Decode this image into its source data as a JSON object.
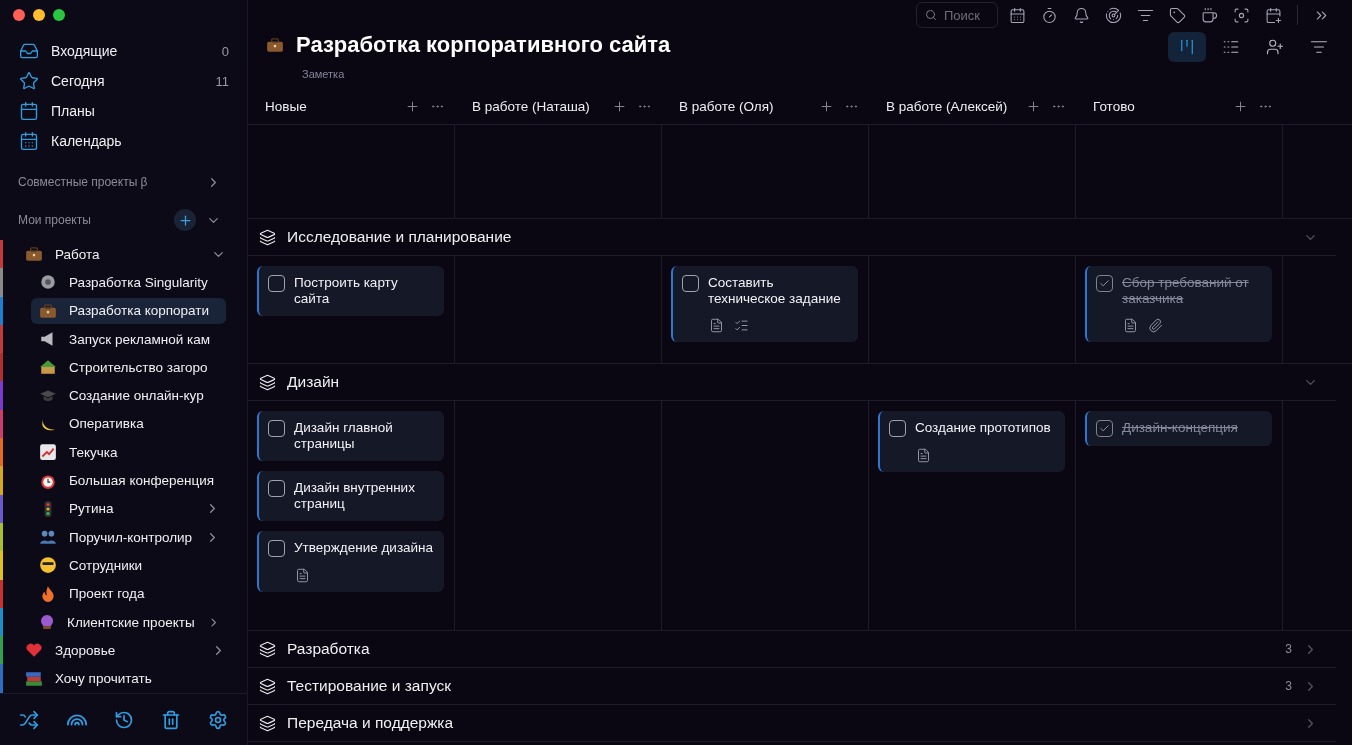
{
  "sidebar": {
    "nav": [
      {
        "label": "Входящие",
        "count": "0"
      },
      {
        "label": "Сегодня",
        "count": "11"
      },
      {
        "label": "Планы"
      },
      {
        "label": "Календарь"
      }
    ],
    "shared_projects": {
      "label": "Совместные проекты β",
      "expanded": false
    },
    "my_projects": {
      "label": "Мои проекты",
      "expanded": true
    },
    "projects": [
      {
        "label": "Работа",
        "color": "#c23a3a",
        "expanded": true,
        "selected": false,
        "children": [
          {
            "label": "Разработка Singularity",
            "color": "#8a8a8a",
            "selected": false
          },
          {
            "label": "Разработка корпорати",
            "color": "#1e7fd0",
            "selected": true
          },
          {
            "label": "Запуск рекламной кам",
            "color": "#c23a3a",
            "selected": false
          },
          {
            "label": "Строительство загоро",
            "color": "#b03030",
            "selected": false
          },
          {
            "label": "Создание онлайн-кур",
            "color": "#7a3cc8",
            "selected": false
          },
          {
            "label": "Оперативка",
            "color": "#c8406a",
            "selected": false
          },
          {
            "label": "Текучка",
            "color": "#e06a20",
            "selected": false
          },
          {
            "label": "Большая конференция",
            "color": "#d6a820",
            "selected": false
          },
          {
            "label": "Рутина",
            "color": "#6a5ad0",
            "selected": false,
            "expanded": false
          },
          {
            "label": "Поручил-контролир",
            "color": "#a8c030",
            "selected": false,
            "expanded": false
          },
          {
            "label": "Сотрудники",
            "color": "#e0c020",
            "selected": false
          },
          {
            "label": "Проект года",
            "color": "#c83030",
            "selected": false
          },
          {
            "label": "Клиентские проекты",
            "color": "#1a90c8",
            "selected": false,
            "expanded": false
          }
        ]
      },
      {
        "label": "Здоровье",
        "color": "#30a050",
        "expanded": false,
        "selected": false
      },
      {
        "label": "Хочу прочитать",
        "color": "#2a70c0",
        "selected": false
      }
    ]
  },
  "search": {
    "placeholder": "Поиск"
  },
  "views": [
    {
      "selected": true
    },
    {
      "selected": false
    }
  ],
  "page": {
    "title": "Разработка корпоративного сайта",
    "subtitle": "Заметка"
  },
  "columns": [
    {
      "title": "Новые"
    },
    {
      "title": "В работе (Наташа)"
    },
    {
      "title": "В работе (Оля)"
    },
    {
      "title": "В работе (Алексей)"
    },
    {
      "title": "Готово"
    }
  ],
  "sections": [
    {
      "title": "Исследование и планирование",
      "expanded": true,
      "cells": [
        [
          {
            "title": "Построить карту сайта",
            "done": false
          }
        ],
        [],
        [
          {
            "title": "Составить техническое задание",
            "done": false,
            "note": true,
            "checklist": true
          }
        ],
        [],
        [
          {
            "title": "Сбор требований от заказчика",
            "done": true,
            "note": true,
            "attachment": true
          }
        ]
      ]
    },
    {
      "title": "Дизайн",
      "expanded": true,
      "cells": [
        [
          {
            "title": "Дизайн главной страницы",
            "done": false
          },
          {
            "title": "Дизайн внутренних страниц",
            "done": false
          },
          {
            "title": "Утверждение дизайна",
            "done": false,
            "note": true
          }
        ],
        [],
        [],
        [
          {
            "title": "Создание прототипов",
            "done": false,
            "note": true
          }
        ],
        [
          {
            "title": "Дизайн-концепция",
            "done": true
          }
        ]
      ]
    },
    {
      "title": "Разработка",
      "expanded": false,
      "count": "3"
    },
    {
      "title": "Тестирование и запуск",
      "expanded": false,
      "count": "3"
    },
    {
      "title": "Передача и поддержка",
      "expanded": false
    }
  ]
}
